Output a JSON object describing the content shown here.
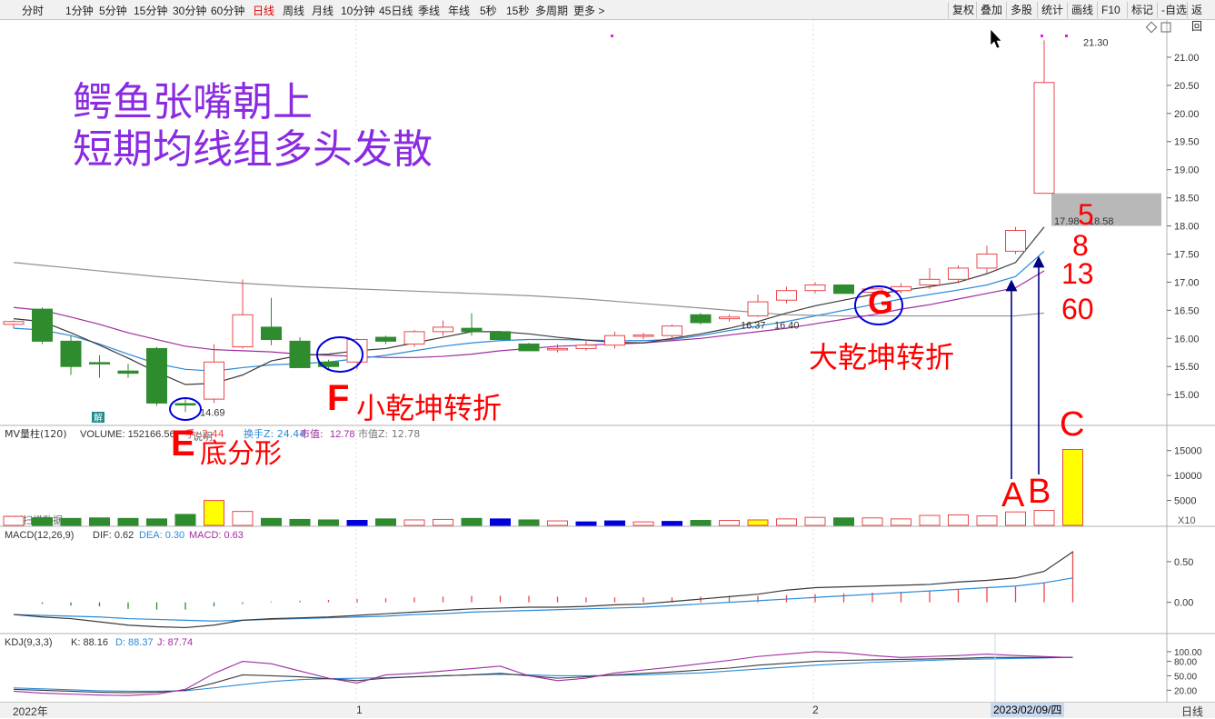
{
  "toolbar": {
    "periods": [
      "分时",
      "1分钟",
      "5分钟",
      "15分钟",
      "30分钟",
      "60分钟",
      "日线",
      "周线",
      "月线",
      "10分钟",
      "45日线",
      "季线",
      "年线",
      "5秒",
      "15秒",
      "多周期",
      "更多 >"
    ],
    "active": "日线",
    "right_buttons": [
      "复权",
      "叠加",
      "多股",
      "统计",
      "画线",
      "F10",
      "标记",
      "-自选",
      "返回"
    ]
  },
  "annotations": {
    "title_line1": "鳄鱼张嘴朝上",
    "title_line2": "短期均线组多头发散",
    "E": "E",
    "E_text": "底分形",
    "F": "F",
    "F_text": "小乾坤转折",
    "G": "G",
    "G_text": "大乾坤转折",
    "ma5": "5",
    "ma8": "8",
    "ma13": "13",
    "ma60": "60",
    "A": "A",
    "B": "B",
    "C": "C"
  },
  "price_labels": {
    "high": "21.30",
    "low": "14.69",
    "ma_a": "16.37",
    "ma_b": "16.40",
    "ma_c": "17.98",
    "ma_d": "18.58",
    "jie": "解",
    "shuoming": "说明"
  },
  "volume_info": {
    "title": "MV量柱(120)",
    "volume": "VOLUME: 152166.56",
    "hand": "手: 2.44",
    "turnover": "换手Z: 24.44",
    "mktcap_label": "市值:",
    "mktcap": "12.78",
    "mktcapz": "市值Z: 12.78",
    "bottom_left": "用到扫描数据",
    "multiplier": "X10"
  },
  "macd_info": {
    "title": "MACD(12,26,9)",
    "dif": "DIF: 0.62",
    "dea": "DEA: 0.30",
    "macd": "MACD: 0.63"
  },
  "kdj_info": {
    "title": "KDJ(9,3,3)",
    "k": "K: 88.16",
    "d": "D: 88.37",
    "j": "J: 87.74"
  },
  "time_axis": {
    "year": "2022年",
    "m1": "1",
    "m2": "2",
    "date": "2023/02/09/四",
    "period": "日线"
  },
  "colors": {
    "up": "#e8484c",
    "down": "#2e8b2e",
    "ma5": "#3a3a3a",
    "ma8": "#2b8ad8",
    "ma13": "#a02ca0",
    "ma60": "#909090",
    "annotation_red": "#ff0000",
    "title_purple": "#8a2be2",
    "circle_blue": "#0000dd",
    "arrow": "#000080"
  },
  "chart_data": {
    "type": "candlestick",
    "price_axis": {
      "ticks": [
        15.0,
        15.5,
        16.0,
        16.5,
        17.0,
        17.5,
        18.0,
        18.5,
        19.0,
        19.5,
        20.0,
        20.5,
        21.0
      ],
      "range": [
        14.55,
        21.5
      ]
    },
    "candles": [
      {
        "o": 16.25,
        "h": 16.32,
        "l": 16.18,
        "c": 16.3
      },
      {
        "o": 16.52,
        "h": 16.55,
        "l": 15.9,
        "c": 15.95
      },
      {
        "o": 15.95,
        "h": 16.05,
        "l": 15.35,
        "c": 15.5
      },
      {
        "o": 15.57,
        "h": 15.7,
        "l": 15.3,
        "c": 15.55
      },
      {
        "o": 15.42,
        "h": 15.55,
        "l": 15.3,
        "c": 15.38
      },
      {
        "o": 15.82,
        "h": 15.85,
        "l": 14.8,
        "c": 14.85
      },
      {
        "o": 14.84,
        "h": 14.95,
        "l": 14.69,
        "c": 14.82
      },
      {
        "o": 14.92,
        "h": 15.9,
        "l": 14.85,
        "c": 15.58
      },
      {
        "o": 15.85,
        "h": 17.05,
        "l": 15.82,
        "c": 16.42
      },
      {
        "o": 16.2,
        "h": 16.72,
        "l": 15.88,
        "c": 15.98
      },
      {
        "o": 15.95,
        "h": 16.02,
        "l": 15.48,
        "c": 15.48
      },
      {
        "o": 15.58,
        "h": 15.62,
        "l": 15.45,
        "c": 15.5
      },
      {
        "o": 15.58,
        "h": 16.0,
        "l": 15.45,
        "c": 15.98
      },
      {
        "o": 16.02,
        "h": 16.05,
        "l": 15.9,
        "c": 15.95
      },
      {
        "o": 15.9,
        "h": 16.15,
        "l": 15.85,
        "c": 16.12
      },
      {
        "o": 16.12,
        "h": 16.32,
        "l": 16.05,
        "c": 16.2
      },
      {
        "o": 16.18,
        "h": 16.45,
        "l": 16.05,
        "c": 16.12
      },
      {
        "o": 16.12,
        "h": 16.13,
        "l": 15.98,
        "c": 15.98
      },
      {
        "o": 15.9,
        "h": 15.92,
        "l": 15.78,
        "c": 15.78
      },
      {
        "o": 15.8,
        "h": 15.9,
        "l": 15.75,
        "c": 15.82
      },
      {
        "o": 15.82,
        "h": 15.95,
        "l": 15.78,
        "c": 15.88
      },
      {
        "o": 15.88,
        "h": 16.12,
        "l": 15.82,
        "c": 16.05
      },
      {
        "o": 16.04,
        "h": 16.1,
        "l": 15.98,
        "c": 16.06
      },
      {
        "o": 16.05,
        "h": 16.25,
        "l": 16.0,
        "c": 16.22
      },
      {
        "o": 16.42,
        "h": 16.45,
        "l": 16.25,
        "c": 16.28
      },
      {
        "o": 16.35,
        "h": 16.42,
        "l": 16.3,
        "c": 16.38
      },
      {
        "o": 16.4,
        "h": 16.78,
        "l": 16.38,
        "c": 16.65
      },
      {
        "o": 16.68,
        "h": 16.92,
        "l": 16.62,
        "c": 16.85
      },
      {
        "o": 16.85,
        "h": 17.0,
        "l": 16.8,
        "c": 16.95
      },
      {
        "o": 16.95,
        "h": 16.96,
        "l": 16.8,
        "c": 16.8
      },
      {
        "o": 16.82,
        "h": 16.9,
        "l": 16.78,
        "c": 16.88
      },
      {
        "o": 16.85,
        "h": 16.98,
        "l": 16.8,
        "c": 16.92
      },
      {
        "o": 16.95,
        "h": 17.25,
        "l": 16.88,
        "c": 17.05
      },
      {
        "o": 17.05,
        "h": 17.3,
        "l": 16.98,
        "c": 17.25
      },
      {
        "o": 17.25,
        "h": 17.65,
        "l": 17.15,
        "c": 17.5
      },
      {
        "o": 17.55,
        "h": 17.98,
        "l": 17.5,
        "c": 17.92
      },
      {
        "o": 18.58,
        "h": 21.3,
        "l": 18.58,
        "c": 20.55
      }
    ],
    "ma5": [
      16.35,
      16.3,
      16.1,
      15.88,
      15.65,
      15.4,
      15.18,
      15.2,
      15.35,
      15.6,
      15.7,
      15.72,
      15.78,
      15.82,
      15.92,
      16.02,
      16.12,
      16.12,
      16.08,
      16.02,
      15.97,
      15.93,
      15.92,
      16.0,
      16.08,
      16.18,
      16.3,
      16.45,
      16.58,
      16.68,
      16.78,
      16.85,
      16.92,
      17.0,
      17.15,
      17.35,
      17.98
    ],
    "ma8": [
      16.18,
      16.15,
      16.05,
      15.9,
      15.72,
      15.55,
      15.45,
      15.42,
      15.48,
      15.53,
      15.55,
      15.58,
      15.64,
      15.7,
      15.78,
      15.86,
      15.92,
      15.96,
      15.98,
      15.98,
      15.97,
      15.96,
      15.96,
      15.98,
      16.05,
      16.14,
      16.22,
      16.3,
      16.4,
      16.5,
      16.6,
      16.7,
      16.78,
      16.86,
      16.95,
      17.1,
      17.55
    ],
    "ma13": [
      16.55,
      16.5,
      16.38,
      16.25,
      16.1,
      15.98,
      15.86,
      15.8,
      15.78,
      15.76,
      15.72,
      15.7,
      15.68,
      15.66,
      15.66,
      15.68,
      15.72,
      15.78,
      15.82,
      15.86,
      15.88,
      15.9,
      15.92,
      15.96,
      16.0,
      16.06,
      16.12,
      16.18,
      16.26,
      16.34,
      16.42,
      16.52,
      16.6,
      16.7,
      16.8,
      16.9,
      17.2
    ],
    "ma60": [
      17.35,
      17.3,
      17.25,
      17.2,
      17.15,
      17.1,
      17.06,
      17.02,
      16.98,
      16.95,
      16.92,
      16.9,
      16.88,
      16.86,
      16.84,
      16.82,
      16.8,
      16.78,
      16.76,
      16.73,
      16.7,
      16.66,
      16.62,
      16.58,
      16.54,
      16.5,
      16.46,
      16.42,
      16.41,
      16.4,
      16.4,
      16.4,
      16.4,
      16.4,
      16.4,
      16.4,
      16.45
    ],
    "volume": {
      "ticks": [
        5000,
        10000,
        15000
      ],
      "range": [
        0,
        17500
      ],
      "bars": [
        1800,
        1500,
        1400,
        1500,
        1400,
        1300,
        2200,
        5000,
        2800,
        1400,
        1200,
        1100,
        1000,
        1300,
        1100,
        1200,
        1400,
        1300,
        1100,
        900,
        700,
        900,
        700,
        800,
        1000,
        1000,
        1100,
        1300,
        1600,
        1500,
        1500,
        1300,
        2000,
        2100,
        1900,
        2700,
        3000,
        15216
      ]
    },
    "macd": {
      "ticks": [
        0.0,
        0.5
      ],
      "range": [
        -0.35,
        0.8
      ],
      "dif": [
        -0.15,
        -0.18,
        -0.2,
        -0.24,
        -0.28,
        -0.3,
        -0.31,
        -0.28,
        -0.22,
        -0.2,
        -0.19,
        -0.18,
        -0.16,
        -0.14,
        -0.12,
        -0.1,
        -0.08,
        -0.07,
        -0.06,
        -0.06,
        -0.05,
        -0.03,
        -0.02,
        0.01,
        0.04,
        0.07,
        0.1,
        0.15,
        0.18,
        0.19,
        0.2,
        0.21,
        0.22,
        0.25,
        0.27,
        0.3,
        0.38,
        0.62
      ],
      "dea": [
        -0.15,
        -0.16,
        -0.17,
        -0.18,
        -0.2,
        -0.21,
        -0.22,
        -0.23,
        -0.22,
        -0.21,
        -0.2,
        -0.19,
        -0.18,
        -0.17,
        -0.15,
        -0.14,
        -0.12,
        -0.11,
        -0.1,
        -0.09,
        -0.08,
        -0.07,
        -0.06,
        -0.04,
        -0.02,
        0.0,
        0.02,
        0.04,
        0.06,
        0.08,
        0.1,
        0.12,
        0.14,
        0.16,
        0.18,
        0.2,
        0.24,
        0.3
      ],
      "hist": [
        0.0,
        -0.02,
        -0.04,
        -0.05,
        -0.08,
        -0.09,
        -0.09,
        -0.05,
        -0.02,
        0.01,
        0.02,
        0.03,
        0.04,
        0.05,
        0.06,
        0.07,
        0.08,
        0.08,
        0.08,
        0.07,
        0.06,
        0.06,
        0.06,
        0.06,
        0.07,
        0.08,
        0.08,
        0.09,
        0.1,
        0.11,
        0.12,
        0.13,
        0.14,
        0.16,
        0.18,
        0.2,
        0.24,
        0.63
      ]
    },
    "kdj": {
      "ticks": [
        20.0,
        30.0,
        40.0,
        50.0,
        60.0,
        80.0,
        100.0
      ],
      "range": [
        0,
        115
      ],
      "k": [
        22,
        20,
        18,
        16,
        15,
        16,
        20,
        35,
        52,
        50,
        48,
        44,
        40,
        45,
        48,
        50,
        52,
        55,
        50,
        45,
        48,
        52,
        55,
        58,
        62,
        66,
        72,
        76,
        80,
        82,
        83,
        84,
        85,
        86,
        88,
        88,
        88,
        88.16
      ],
      "d": [
        25,
        23,
        21,
        19,
        18,
        18,
        19,
        25,
        32,
        38,
        42,
        44,
        45,
        46,
        48,
        50,
        52,
        53,
        52,
        50,
        50,
        51,
        52,
        54,
        56,
        60,
        64,
        68,
        72,
        75,
        78,
        80,
        82,
        84,
        85,
        86,
        87,
        88.37
      ],
      "j": [
        18,
        14,
        12,
        10,
        9,
        12,
        22,
        55,
        80,
        75,
        60,
        45,
        35,
        52,
        55,
        60,
        65,
        70,
        50,
        40,
        45,
        56,
        62,
        68,
        75,
        82,
        90,
        95,
        100,
        98,
        92,
        88,
        90,
        92,
        95,
        92,
        90,
        87.74
      ]
    }
  }
}
